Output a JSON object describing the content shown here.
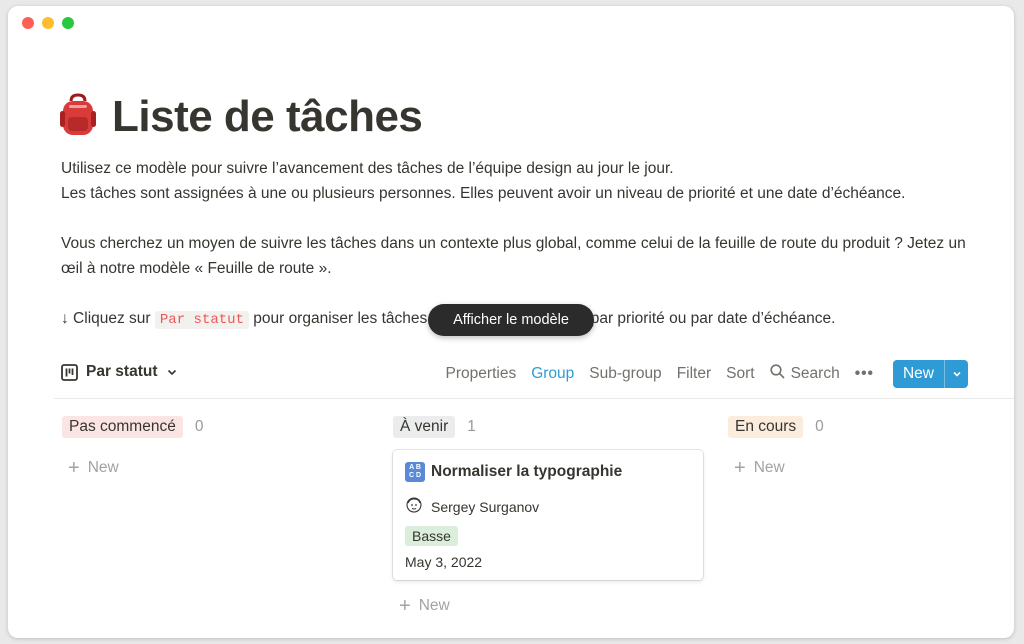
{
  "page": {
    "title": "Liste de tâches",
    "description": {
      "line1": "Utilisez ce modèle pour suivre l’avancement des tâches de l’équipe design au jour le jour.",
      "line2": "Les tâches sont assignées à une ou plusieurs personnes. Elles peuvent avoir un niveau de priorité et une date d’échéance.",
      "line3": "Vous cherchez un moyen de suivre les tâches dans un contexte plus global, comme celui de la feuille de route du produit ? Jetez un œil à notre modèle « Feuille de route ».",
      "line4_prefix": "↓ Cliquez sur",
      "line4_code": "Par statut",
      "line4_suffix": "pour organiser les tâches par personne affectée, par priorité ou par date d’échéance."
    }
  },
  "tooltip": {
    "label": "Afficher le modèle"
  },
  "toolbar": {
    "view_label": "Par statut",
    "properties": "Properties",
    "group": "Group",
    "subgroup": "Sub-group",
    "filter": "Filter",
    "sort": "Sort",
    "search": "Search",
    "more": "•••",
    "new_label": "New",
    "accent_color": "#2e9bd6"
  },
  "columns": [
    {
      "label": "Pas commencé",
      "count": "0",
      "color": "#fbe4e4",
      "add_label": "New"
    },
    {
      "label": "À venir",
      "count": "1",
      "color": "#ebeced",
      "add_label": "New",
      "cards": [
        {
          "title": "Normaliser la typographie",
          "icon": "abcd-icon",
          "assignee": "Sergey Surganov",
          "priority": "Basse",
          "priority_color": "#dbeddb",
          "date": "May 3, 2022"
        }
      ]
    },
    {
      "label": "En cours",
      "count": "0",
      "color": "#fbecdd",
      "add_label": "New"
    }
  ]
}
